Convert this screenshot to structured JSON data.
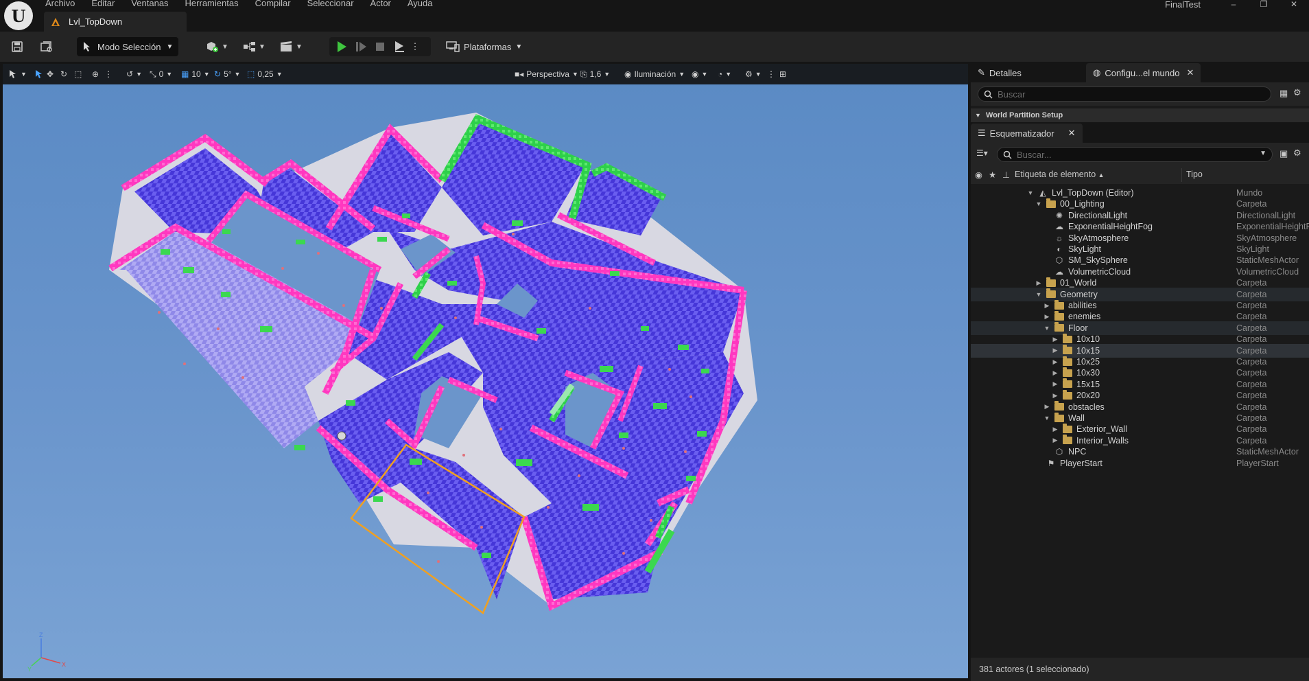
{
  "menu": [
    "Archivo",
    "Editar",
    "Ventanas",
    "Herramientas",
    "Compilar",
    "Seleccionar",
    "Actor",
    "Ayuda"
  ],
  "window_title": "FinalTest",
  "document_tab": "Lvl_TopDown",
  "toolbar": {
    "mode_label": "Modo Selección",
    "platforms_label": "Plataformas"
  },
  "viewport_toolbar": {
    "translate_snap": "0",
    "grid_snap": "10",
    "rotate_snap": "5°",
    "scale_snap": "0,25",
    "view_mode": "Perspectiva",
    "camera_speed": "1,6",
    "lighting": "Iluminación"
  },
  "axis_labels": {
    "x": "X",
    "y": "Y",
    "z": "Z"
  },
  "details_panel": {
    "tab_details": "Detalles",
    "tab_world": "Configu...el mundo",
    "search_placeholder": "Buscar",
    "section": "World Partition Setup"
  },
  "outliner": {
    "tab": "Esquematizador",
    "search_placeholder": "Buscar...",
    "col_label": "Etiqueta de elemento",
    "col_type": "Tipo",
    "rows": [
      {
        "name": "Lvl_TopDown (Editor)",
        "type": "Mundo",
        "depth": 0,
        "caret": "down",
        "icon": "world-icon"
      },
      {
        "name": "00_Lighting",
        "type": "Carpeta",
        "depth": 1,
        "caret": "down",
        "icon": "folder-open-icon"
      },
      {
        "name": "DirectionalLight",
        "type": "DirectionalLight",
        "depth": 2,
        "caret": "",
        "icon": "sun-icon"
      },
      {
        "name": "ExponentialHeightFog",
        "type": "ExponentialHeightFog",
        "depth": 2,
        "caret": "",
        "icon": "fog-icon"
      },
      {
        "name": "SkyAtmosphere",
        "type": "SkyAtmosphere",
        "depth": 2,
        "caret": "",
        "icon": "sky-icon"
      },
      {
        "name": "SkyLight",
        "type": "SkyLight",
        "depth": 2,
        "caret": "",
        "icon": "skylight-icon"
      },
      {
        "name": "SM_SkySphere",
        "type": "StaticMeshActor",
        "depth": 2,
        "caret": "",
        "icon": "mesh-icon"
      },
      {
        "name": "VolumetricCloud",
        "type": "VolumetricCloud",
        "depth": 2,
        "caret": "",
        "icon": "cloud-icon"
      },
      {
        "name": "01_World",
        "type": "Carpeta",
        "depth": 1,
        "caret": "right",
        "icon": "folder-icon"
      },
      {
        "name": "Geometry",
        "type": "Carpeta",
        "depth": 1,
        "caret": "down",
        "icon": "folder-open-icon",
        "hl": true
      },
      {
        "name": "abilities",
        "type": "Carpeta",
        "depth": 2,
        "caret": "right",
        "icon": "folder-icon"
      },
      {
        "name": "enemies",
        "type": "Carpeta",
        "depth": 2,
        "caret": "right",
        "icon": "folder-icon"
      },
      {
        "name": "Floor",
        "type": "Carpeta",
        "depth": 2,
        "caret": "down",
        "icon": "folder-open-icon",
        "hl": true
      },
      {
        "name": "10x10",
        "type": "Carpeta",
        "depth": 3,
        "caret": "right",
        "icon": "folder-icon"
      },
      {
        "name": "10x15",
        "type": "Carpeta",
        "depth": 3,
        "caret": "right",
        "icon": "folder-icon",
        "sel": true
      },
      {
        "name": "10x25",
        "type": "Carpeta",
        "depth": 3,
        "caret": "right",
        "icon": "folder-icon"
      },
      {
        "name": "10x30",
        "type": "Carpeta",
        "depth": 3,
        "caret": "right",
        "icon": "folder-icon"
      },
      {
        "name": "15x15",
        "type": "Carpeta",
        "depth": 3,
        "caret": "right",
        "icon": "folder-icon"
      },
      {
        "name": "20x20",
        "type": "Carpeta",
        "depth": 3,
        "caret": "right",
        "icon": "folder-icon"
      },
      {
        "name": "obstacles",
        "type": "Carpeta",
        "depth": 2,
        "caret": "right",
        "icon": "folder-icon"
      },
      {
        "name": "Wall",
        "type": "Carpeta",
        "depth": 2,
        "caret": "down",
        "icon": "folder-open-icon"
      },
      {
        "name": "Exterior_Wall",
        "type": "Carpeta",
        "depth": 3,
        "caret": "right",
        "icon": "folder-icon"
      },
      {
        "name": "Interior_Walls",
        "type": "Carpeta",
        "depth": 3,
        "caret": "right",
        "icon": "folder-icon"
      },
      {
        "name": "NPC",
        "type": "StaticMeshActor",
        "depth": 2,
        "caret": "",
        "icon": "mesh-icon"
      },
      {
        "name": "PlayerStart",
        "type": "PlayerStart",
        "depth": 1,
        "caret": "",
        "icon": "player-start-icon"
      }
    ],
    "status": "381 actores (1 seleccionado)"
  },
  "colors": {
    "sky": "#6a95cc",
    "floor": "#3b2fd6",
    "wall": "#ff3fc0",
    "obstacle": "#38d84f",
    "selection": "#f0a020",
    "play": "#3fc53f"
  }
}
